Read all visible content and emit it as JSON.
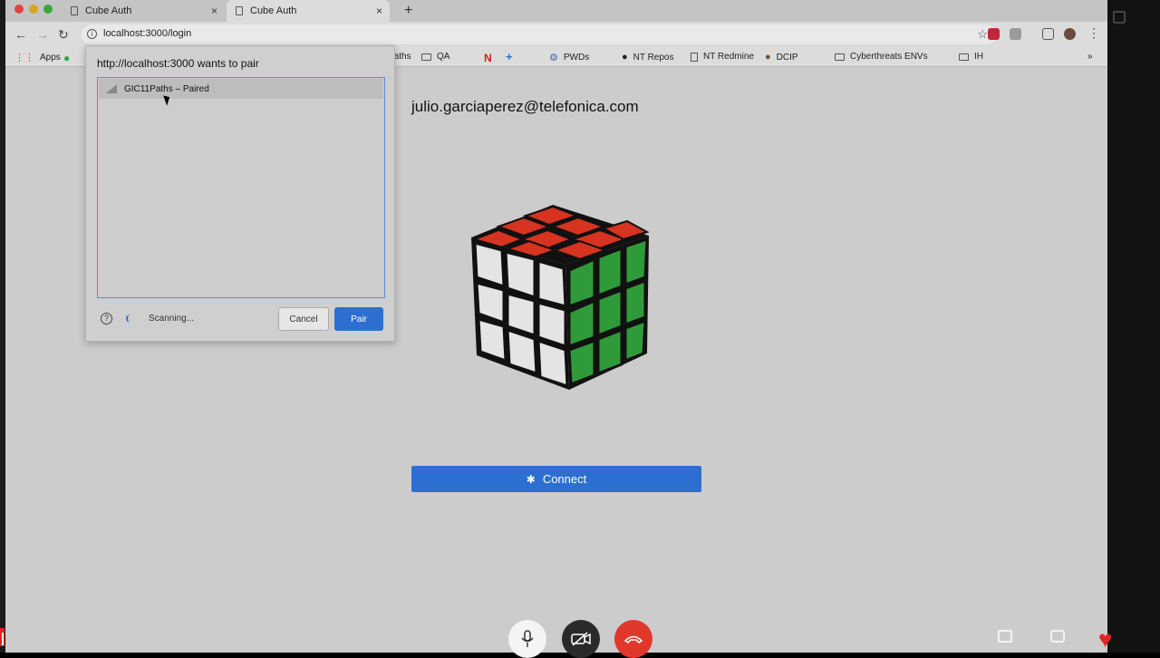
{
  "tabs": [
    {
      "title": "Cube Auth",
      "close": "×"
    },
    {
      "title": "Cube Auth",
      "close": "×"
    }
  ],
  "new_tab": "+",
  "omnibox": {
    "url": "localhost:3000/login"
  },
  "bookmarks": [
    {
      "label": "Apps"
    },
    {
      "label": "Paths"
    },
    {
      "label": "QA"
    },
    {
      "label": "PWDs"
    },
    {
      "label": "NT Repos"
    },
    {
      "label": "NT Redmine"
    },
    {
      "label": "DCIP"
    },
    {
      "label": "Cyberthreats ENVs"
    },
    {
      "label": "IH"
    }
  ],
  "bookmarks_overflow": "»",
  "page": {
    "email": "julio.garciaperez@telefonica.com",
    "connect_label": "Connect"
  },
  "dialog": {
    "title": "http://localhost:3000 wants to pair",
    "devices": [
      {
        "name": "GIC11Paths – Paired"
      }
    ],
    "status": "Scanning...",
    "cancel_label": "Cancel",
    "pair_label": "Pair"
  },
  "colors": {
    "accent": "#2d6fd0",
    "hangup": "#e0382d",
    "page_bg": "#cccccc"
  }
}
